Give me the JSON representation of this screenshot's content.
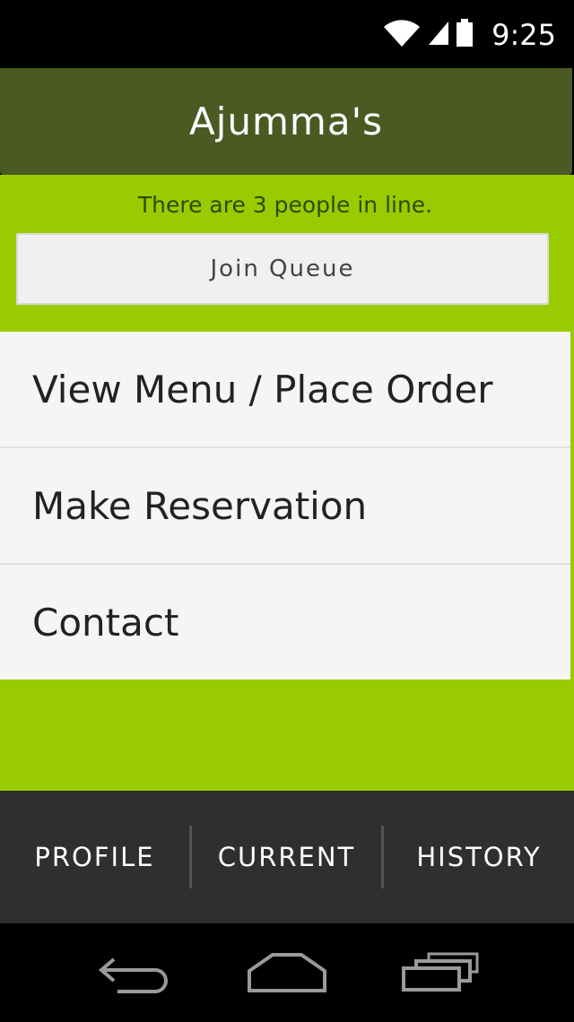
{
  "status_bar": {
    "time": "9:25",
    "icons": [
      "wifi-icon",
      "signal-icon",
      "battery-icon"
    ]
  },
  "header": {
    "title": "Ajumma's"
  },
  "queue": {
    "status_text": "There are 3 people in line.",
    "join_label": "Join Queue"
  },
  "menu": {
    "items": [
      {
        "label": "View Menu / Place Order"
      },
      {
        "label": "Make Reservation"
      },
      {
        "label": "Contact"
      }
    ]
  },
  "tabs": [
    {
      "label": "PROFILE"
    },
    {
      "label": "CURRENT"
    },
    {
      "label": "HISTORY"
    }
  ],
  "nav": {
    "icons": [
      "back-icon",
      "home-icon",
      "recent-apps-icon"
    ]
  },
  "colors": {
    "header_bg": "#4a5a22",
    "accent_green": "#99cc00",
    "tab_bar_bg": "#2f2f2f"
  }
}
